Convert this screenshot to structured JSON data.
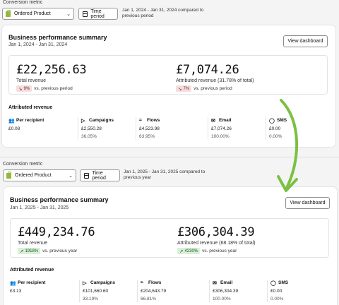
{
  "top": {
    "metric_label": "Conversion metric",
    "metric_value": "Ordered Product",
    "time_button": "Time period",
    "date_note_line1": "Jan 1, 2024 - Jan 31, 2024 compared to",
    "date_note_line2": "previous period",
    "card": {
      "title": "Business performance summary",
      "range": "Jan 1, 2024 - Jan 31, 2024",
      "button": "View dashboard",
      "total_revenue": "£22,256.63",
      "total_label": "Total revenue",
      "total_delta": "9%",
      "total_delta_dir": "down",
      "total_delta_suffix": "vs. previous period",
      "attributed_revenue": "£7,074.26",
      "attributed_label": "Attributed revenue (31.78% of total)",
      "attributed_delta": "7%",
      "attributed_delta_dir": "down",
      "attributed_delta_suffix": "vs. previous period",
      "attr_title": "Attributed revenue",
      "columns": [
        {
          "icon": "people-icon",
          "label": "Per recipient",
          "value": "£0.08",
          "pct": ""
        },
        {
          "icon": "campaign-icon",
          "label": "Campaigns",
          "value": "£2,550.28",
          "pct": "36.05%"
        },
        {
          "icon": "flows-icon",
          "label": "Flows",
          "value": "£4,523.98",
          "pct": "63.95%"
        },
        {
          "icon": "email-icon",
          "label": "Email",
          "value": "£7,074.26",
          "pct": "100.00%"
        },
        {
          "icon": "sms-icon",
          "label": "SMS",
          "value": "£0.00",
          "pct": "0.00%"
        }
      ]
    }
  },
  "bottom": {
    "metric_label": "Conversion metric",
    "metric_value": "Ordered Product",
    "time_button": "Time period",
    "date_note_line1": "Jan 1, 2025 - Jan 31, 2025 compared to",
    "date_note_line2": "previous year",
    "card": {
      "title": "Business performance summary",
      "range": "Jan 1, 2025 - Jan 31, 2025",
      "button": "View dashboard",
      "total_revenue": "£449,234.76",
      "total_label": "Total revenue",
      "total_delta": "1918%",
      "total_delta_dir": "up",
      "total_delta_suffix": "vs. previous year",
      "attributed_revenue": "£306,304.39",
      "attributed_label": "Attributed revenue (68.18% of total)",
      "attributed_delta": "4230%",
      "attributed_delta_dir": "up",
      "attributed_delta_suffix": "vs. previous year",
      "attr_title": "Attributed revenue",
      "columns": [
        {
          "icon": "people-icon",
          "label": "Per recipient",
          "value": "£3.13",
          "pct": ""
        },
        {
          "icon": "campaign-icon",
          "label": "Campaigns",
          "value": "£101,660.60",
          "pct": "33.19%"
        },
        {
          "icon": "flows-icon",
          "label": "Flows",
          "value": "£204,643.79",
          "pct": "66.81%"
        },
        {
          "icon": "email-icon",
          "label": "Email",
          "value": "£306,304.39",
          "pct": "100.00%"
        },
        {
          "icon": "sms-icon",
          "label": "SMS",
          "value": "£0.00",
          "pct": "0.00%"
        }
      ]
    }
  },
  "colors": {
    "arrow": "#7cc043",
    "pill_down": "#f3dede",
    "pill_up": "#d8efd8"
  }
}
